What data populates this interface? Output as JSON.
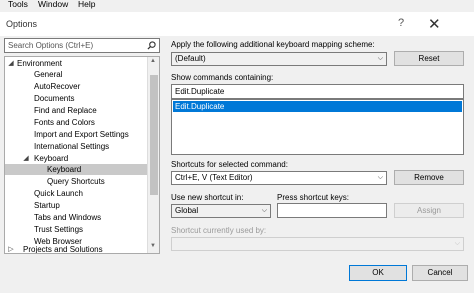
{
  "menu": [
    "Tools",
    "Window",
    "Help"
  ],
  "dialog": {
    "title": "Options",
    "help_glyph": "?",
    "close_glyph": "✕"
  },
  "search": {
    "placeholder": "Search Options (Ctrl+E)"
  },
  "tree": {
    "environment": "Environment",
    "items": [
      "General",
      "AutoRecover",
      "Documents",
      "Find and Replace",
      "Fonts and Colors",
      "Import and Export Settings",
      "International Settings"
    ],
    "keyboard": "Keyboard",
    "keyboard_children": [
      "Keyboard",
      "Query Shortcuts"
    ],
    "items_after": [
      "Quick Launch",
      "Startup",
      "Tabs and Windows",
      "Trust Settings",
      "Web Browser"
    ],
    "projects": "Projects and Solutions",
    "selected": "Keyboard"
  },
  "mapping": {
    "label": "Apply the following additional keyboard mapping scheme:",
    "value": "(Default)",
    "reset_label": "Reset"
  },
  "commands": {
    "label": "Show commands containing:",
    "value": "Edit.Duplicate",
    "results": [
      "Edit.Duplicate"
    ]
  },
  "shortcuts": {
    "label": "Shortcuts for selected command:",
    "value": "Ctrl+E, V (Text Editor)",
    "remove_label": "Remove"
  },
  "new_shortcut": {
    "use_label": "Use new shortcut in:",
    "use_value": "Global",
    "press_label": "Press shortcut keys:",
    "press_value": "",
    "assign_label": "Assign"
  },
  "currently_used": {
    "label": "Shortcut currently used by:",
    "value": ""
  },
  "footer": {
    "ok_label": "OK",
    "cancel_label": "Cancel"
  }
}
